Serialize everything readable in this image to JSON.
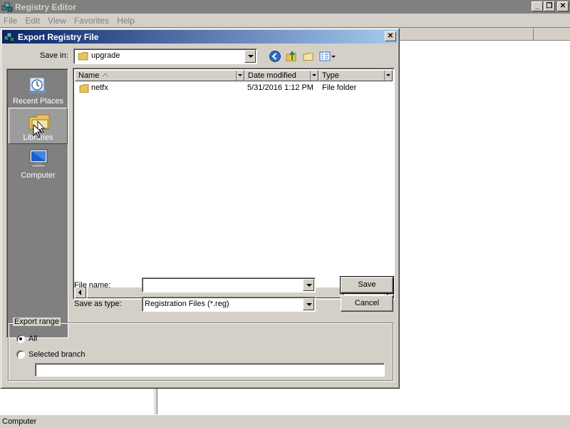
{
  "main_window": {
    "title": "Registry Editor",
    "menu": [
      "File",
      "Edit",
      "View",
      "Favorites",
      "Help"
    ],
    "status": "Computer"
  },
  "dialog": {
    "title": "Export Registry File",
    "save_in_label": "Save in:",
    "save_in_value": "upgrade",
    "places": [
      {
        "label": "Recent Places",
        "icon": "recent-places-icon"
      },
      {
        "label": "Libraries",
        "icon": "libraries-icon",
        "selected": true
      },
      {
        "label": "Computer",
        "icon": "computer-icon"
      }
    ],
    "columns": [
      "Name",
      "Date modified",
      "Type"
    ],
    "files": [
      {
        "name": "netfx",
        "date": "5/31/2016 1:12 PM",
        "type": "File folder"
      }
    ],
    "file_name_label": "File name:",
    "file_name_value": "",
    "save_as_type_label": "Save as type:",
    "save_as_type_value": "Registration Files (*.reg)",
    "save_button": "Save",
    "cancel_button": "Cancel",
    "export_range": {
      "legend": "Export range",
      "all_label": "All",
      "selected_branch_label": "Selected branch",
      "branch_value": "",
      "selected": "All"
    }
  },
  "colors": {
    "dialog_title_start": "#0a246a",
    "dialog_title_end": "#a6caf0",
    "face": "#d4d0c8",
    "places_bar": "#808080"
  }
}
